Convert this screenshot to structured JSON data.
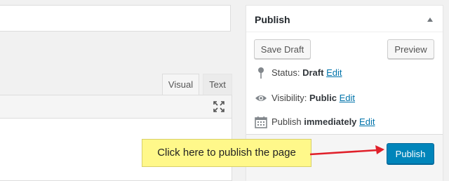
{
  "editor": {
    "tabs": [
      {
        "label": "Visual"
      },
      {
        "label": "Text"
      }
    ],
    "toolbar": {
      "fullscreen_icon": "fullscreen-icon"
    }
  },
  "publish_box": {
    "title": "Publish",
    "toggle_icon": "arrow-up-icon",
    "save_draft_label": "Save Draft",
    "preview_label": "Preview",
    "status": {
      "icon": "pin-icon",
      "label": "Status:",
      "value": "Draft",
      "edit": "Edit"
    },
    "visibility": {
      "icon": "eye-icon",
      "label": "Visibility:",
      "value": "Public",
      "edit": "Edit"
    },
    "schedule": {
      "icon": "calendar-icon",
      "label": "Publish",
      "value": "immediately",
      "edit": "Edit"
    },
    "publish_label": "Publish"
  },
  "callout": {
    "text": "Click here to publish the page",
    "arrow_color": "#e0202a"
  },
  "colors": {
    "primary_button": "#0085ba",
    "link": "#0073aa",
    "callout_bg": "#fff88a"
  }
}
